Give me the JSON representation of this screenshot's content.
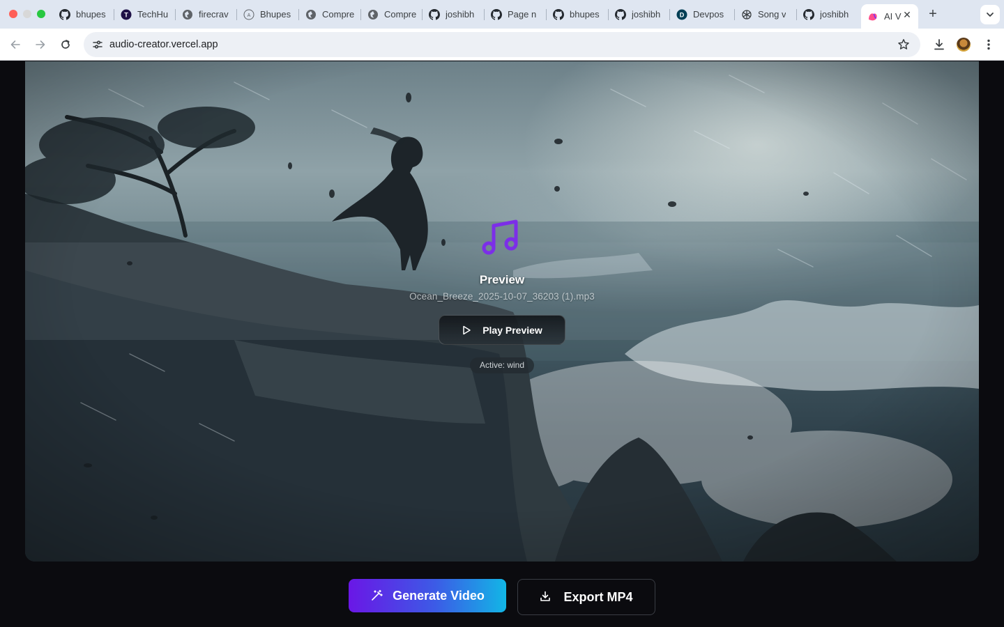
{
  "browser": {
    "tabs": [
      {
        "title": "bhupes",
        "icon": "github-icon"
      },
      {
        "title": "TechHu",
        "icon": "techhub-icon"
      },
      {
        "title": "firecrav",
        "icon": "globe-icon"
      },
      {
        "title": "Bhupes",
        "icon": "profile-icon"
      },
      {
        "title": "Compre",
        "icon": "globe-icon"
      },
      {
        "title": "Compre",
        "icon": "globe-icon"
      },
      {
        "title": "joshibh",
        "icon": "github-icon"
      },
      {
        "title": "Page n",
        "icon": "github-icon"
      },
      {
        "title": "bhupes",
        "icon": "github-icon"
      },
      {
        "title": "joshibh",
        "icon": "github-icon"
      },
      {
        "title": "Devpos",
        "icon": "devpost-icon"
      },
      {
        "title": "Song v",
        "icon": "openai-icon"
      },
      {
        "title": "joshibh",
        "icon": "github-icon"
      },
      {
        "title": "AI V",
        "icon": "app-logo-icon",
        "active": true
      }
    ],
    "url": "audio-creator.vercel.app"
  },
  "preview": {
    "title": "Preview",
    "filename": "Ocean_Breeze_2025-10-07_36203 (1).mp3",
    "play_label": "Play Preview",
    "active_badge": "Active: wind"
  },
  "actions": {
    "generate_label": "Generate Video",
    "export_label": "Export MP4"
  },
  "colors": {
    "music_icon": "#7c2ee8",
    "generate_gradient_start": "#6a17e6",
    "generate_gradient_end": "#12b6e6",
    "page_background": "#0b0b0f"
  }
}
